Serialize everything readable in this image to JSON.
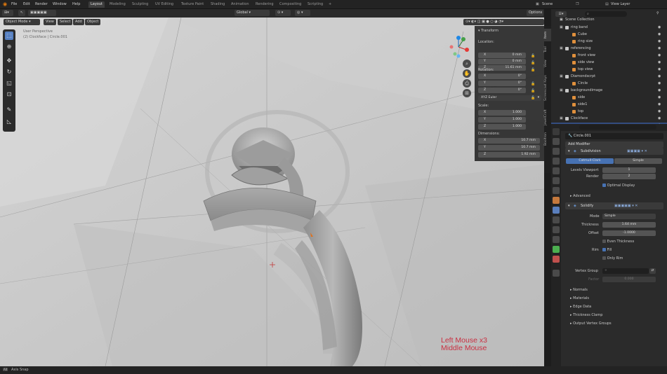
{
  "topbar": {
    "menus": [
      "File",
      "Edit",
      "Render",
      "Window",
      "Help"
    ],
    "workspaces": [
      "Layout",
      "Modeling",
      "Sculpting",
      "UV Editing",
      "Texture Paint",
      "Shading",
      "Animation",
      "Rendering",
      "Compositing",
      "Scripting"
    ],
    "add_tab": "+",
    "scene": "Scene",
    "view_layer": "View Layer"
  },
  "header3d": {
    "mode": "Object Mode",
    "menus": [
      "View",
      "Select",
      "Add",
      "Object"
    ],
    "orientation": "Global",
    "options": "Options"
  },
  "viewport": {
    "view_name": "User Perspective",
    "object_info": "(2) Clockface | Circle.001",
    "keys_line1": "Left Mouse x3",
    "keys_line2": "Middle Mouse",
    "key_color": "#c93042",
    "bg_color": "#c6c6c6"
  },
  "npanel": {
    "title": "Transform",
    "location_label": "Location:",
    "location": [
      {
        "axis": "X",
        "value": "0 mm"
      },
      {
        "axis": "Y",
        "value": "0 mm"
      },
      {
        "axis": "Z",
        "value": "11.61 mm"
      }
    ],
    "rotation_label": "Rotation:",
    "rotation": [
      {
        "axis": "X",
        "value": "0°"
      },
      {
        "axis": "Y",
        "value": "0°"
      },
      {
        "axis": "Z",
        "value": "0°"
      }
    ],
    "rotation_mode": "XYZ Euler",
    "scale_label": "Scale:",
    "scale": [
      {
        "axis": "X",
        "value": "1.000"
      },
      {
        "axis": "Y",
        "value": "1.000"
      },
      {
        "axis": "Z",
        "value": "1.000"
      }
    ],
    "dimensions_label": "Dimensions:",
    "dimensions": [
      {
        "axis": "X",
        "value": "10.7 mm"
      },
      {
        "axis": "Y",
        "value": "10.7 mm"
      },
      {
        "axis": "Z",
        "value": "1.92 mm"
      }
    ],
    "tabs": [
      "Item",
      "Tool",
      "View",
      "Screencast Keys",
      "JewelCraft",
      "Booltron"
    ]
  },
  "outliner": {
    "search_placeholder": "",
    "root": "Scene Collection",
    "rows": [
      {
        "label": "ring band",
        "depth": 1,
        "collection": true,
        "selected": false
      },
      {
        "label": "Cube",
        "depth": 2,
        "collection": false,
        "selected": false
      },
      {
        "label": "ring size",
        "depth": 2,
        "collection": false,
        "selected": false
      },
      {
        "label": "referencing",
        "depth": 1,
        "collection": true,
        "selected": false
      },
      {
        "label": "front view",
        "depth": 2,
        "collection": false,
        "selected": false
      },
      {
        "label": "side view",
        "depth": 2,
        "collection": false,
        "selected": false
      },
      {
        "label": "top view",
        "depth": 2,
        "collection": false,
        "selected": false
      },
      {
        "label": "Diamondscrpt",
        "depth": 1,
        "collection": true,
        "selected": false
      },
      {
        "label": "Circle",
        "depth": 2,
        "collection": false,
        "selected": false
      },
      {
        "label": "backgroundimage",
        "depth": 1,
        "collection": true,
        "selected": false
      },
      {
        "label": "side",
        "depth": 2,
        "collection": false,
        "selected": false
      },
      {
        "label": "side1",
        "depth": 2,
        "collection": false,
        "selected": false
      },
      {
        "label": "top",
        "depth": 2,
        "collection": false,
        "selected": false
      },
      {
        "label": "Clockface",
        "depth": 1,
        "collection": true,
        "selected": false
      },
      {
        "label": "",
        "depth": 2,
        "collection": false,
        "selected": true
      }
    ]
  },
  "properties": {
    "object_name": "Circle.001",
    "add_modifier": "Add Modifier",
    "subdivision": {
      "name": "Subdivision",
      "algo_left": "Catmull-Clark",
      "algo_right": "Simple",
      "levels_viewport_label": "Levels Viewport",
      "levels_viewport": "1",
      "render_label": "Render",
      "render": "2",
      "optimal_display": "Optimal Display",
      "advanced": "Advanced"
    },
    "solidify": {
      "name": "Solidify",
      "mode_label": "Mode",
      "mode": "Simple",
      "thickness_label": "Thickness",
      "thickness": "1.64 mm",
      "offset_label": "Offset",
      "offset": "-1.0000",
      "even_thickness": "Even Thickness",
      "rim_label": "Rim",
      "fill": "Fill",
      "only_rim": "Only Rim",
      "vertex_group_label": "Vertex Group",
      "factor_label": "Factor",
      "factor": "0.000",
      "subpanels": [
        "Normals",
        "Materials",
        "Edge Data",
        "Thickness Clamp",
        "Output Vertex Groups"
      ]
    }
  },
  "status": {
    "key": "Alt",
    "text": "Axis Snap"
  }
}
